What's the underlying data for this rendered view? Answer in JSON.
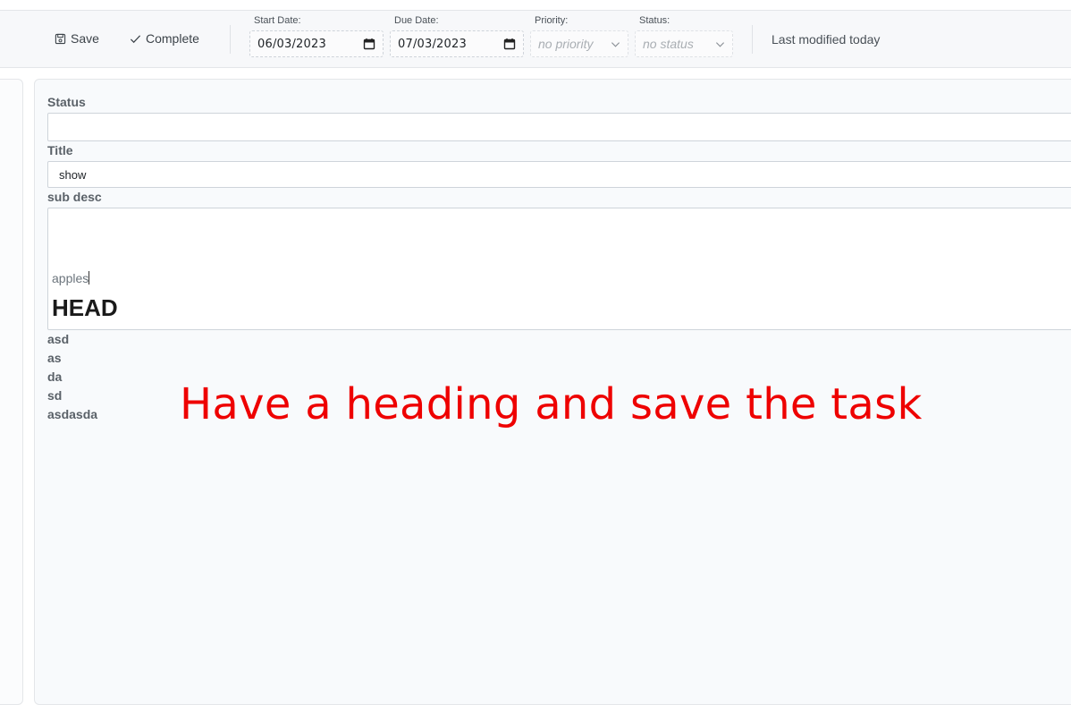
{
  "toolbar": {
    "save_label": "Save",
    "complete_label": "Complete",
    "start_date_label": "Start Date:",
    "start_date_value": "06/03/2023",
    "due_date_label": "Due Date:",
    "due_date_value": "07/03/2023",
    "priority_label": "Priority:",
    "priority_value": "no priority",
    "status_label": "Status:",
    "status_value": "no status",
    "last_modified": "Last modified today"
  },
  "form": {
    "status_label": "Status",
    "status_value": "",
    "title_label": "Title",
    "title_value": "show",
    "sub_desc_label": "sub desc",
    "editor_paragraph": "apples",
    "editor_heading": "HEAD"
  },
  "lines": [
    "asd",
    "as",
    "da",
    "sd",
    "asdasda"
  ],
  "annotation": "Have a heading and save the task",
  "colors": {
    "annotation": "#ee0000",
    "active_tab": "#9cc4ee"
  }
}
